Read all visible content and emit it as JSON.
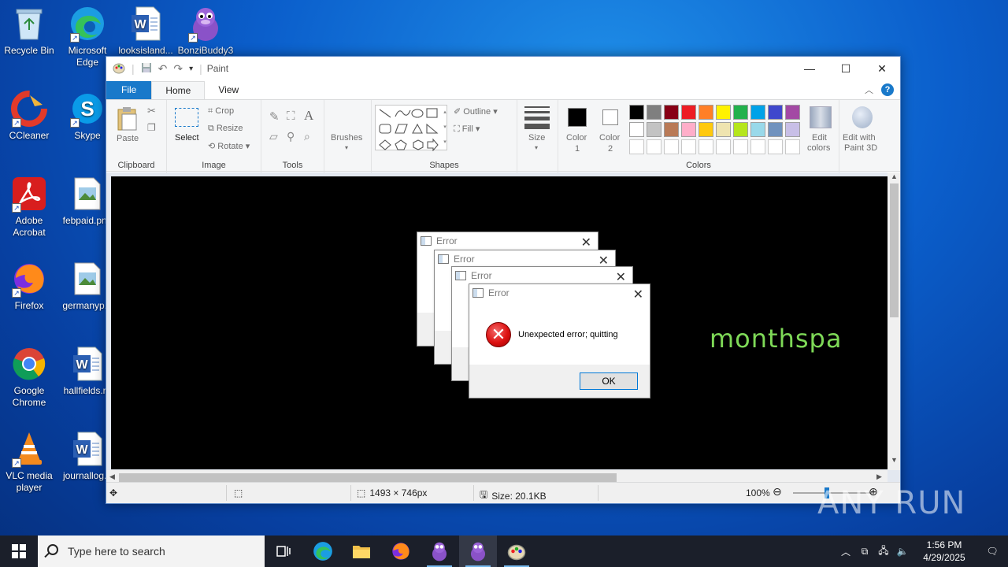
{
  "desktop": {
    "icons": [
      {
        "label": "Recycle Bin",
        "icon": "recycle-bin-icon"
      },
      {
        "label": "Microsoft Edge",
        "icon": "edge-icon"
      },
      {
        "label": "looksisland...",
        "icon": "word-doc-icon"
      },
      {
        "label": "BonziBuddy3",
        "icon": "bonzibuddy-icon"
      },
      {
        "label": "CCleaner",
        "icon": "ccleaner-icon"
      },
      {
        "label": "Skype",
        "icon": "skype-icon"
      },
      {
        "label": "Adobe Acrobat",
        "icon": "acrobat-icon"
      },
      {
        "label": "febpaid.png",
        "icon": "image-file-icon"
      },
      {
        "label": "Firefox",
        "icon": "firefox-icon"
      },
      {
        "label": "germanyp...",
        "icon": "image-file-icon"
      },
      {
        "label": "Google Chrome",
        "icon": "chrome-icon"
      },
      {
        "label": "hallfields.rtf",
        "icon": "word-doc-icon"
      },
      {
        "label": "VLC media player",
        "icon": "vlc-icon"
      },
      {
        "label": "journallog...",
        "icon": "word-doc-icon"
      }
    ]
  },
  "paint": {
    "title": "Paint",
    "window_controls": {
      "minimize": "—",
      "maximize": "☐",
      "close": "✕"
    },
    "tabs": [
      {
        "label": "File"
      },
      {
        "label": "Home"
      },
      {
        "label": "View"
      }
    ],
    "ribbon": {
      "clipboard": {
        "paste": "Paste",
        "group": "Clipboard"
      },
      "image": {
        "select": "Select",
        "crop": "Crop",
        "resize": "Resize",
        "rotate": "Rotate",
        "group": "Image"
      },
      "tools": {
        "group": "Tools"
      },
      "brushes": {
        "label": "Brushes"
      },
      "shapes": {
        "outline": "Outline",
        "fill": "Fill",
        "group": "Shapes"
      },
      "size": {
        "label": "Size"
      },
      "colors": {
        "color1_a": "Color",
        "color1_b": "1",
        "color2_a": "Color",
        "color2_b": "2",
        "edit_colors_a": "Edit",
        "edit_colors_b": "colors",
        "paint3d_a": "Edit with",
        "paint3d_b": "Paint 3D",
        "group": "Colors",
        "palette_row1": [
          "#000000",
          "#7f7f7f",
          "#880015",
          "#ed1c24",
          "#ff7f27",
          "#fff200",
          "#22b14c",
          "#00a2e8",
          "#3f48cc",
          "#a349a4"
        ],
        "palette_row2": [
          "#ffffff",
          "#c3c3c3",
          "#b97a57",
          "#ffaec9",
          "#ffc90e",
          "#efe4b0",
          "#b5e61d",
          "#99d9ea",
          "#7092be",
          "#c8bfe7"
        ]
      }
    },
    "canvas": {
      "text": "monthspa",
      "text_color": "#7ed957"
    },
    "status": {
      "dimensions": "1493 × 746px",
      "size": "Size: 20.1KB",
      "zoom": "100%"
    }
  },
  "dialogs": [
    {
      "title": "Error"
    },
    {
      "title": "Error"
    },
    {
      "title": "Error"
    },
    {
      "title": "Error",
      "message": "Unexpected error; quitting",
      "button": "OK"
    }
  ],
  "watermark": "ANY RUN",
  "taskbar": {
    "search_placeholder": "Type here to search",
    "time": "1:56 PM",
    "date": "4/29/2025"
  }
}
